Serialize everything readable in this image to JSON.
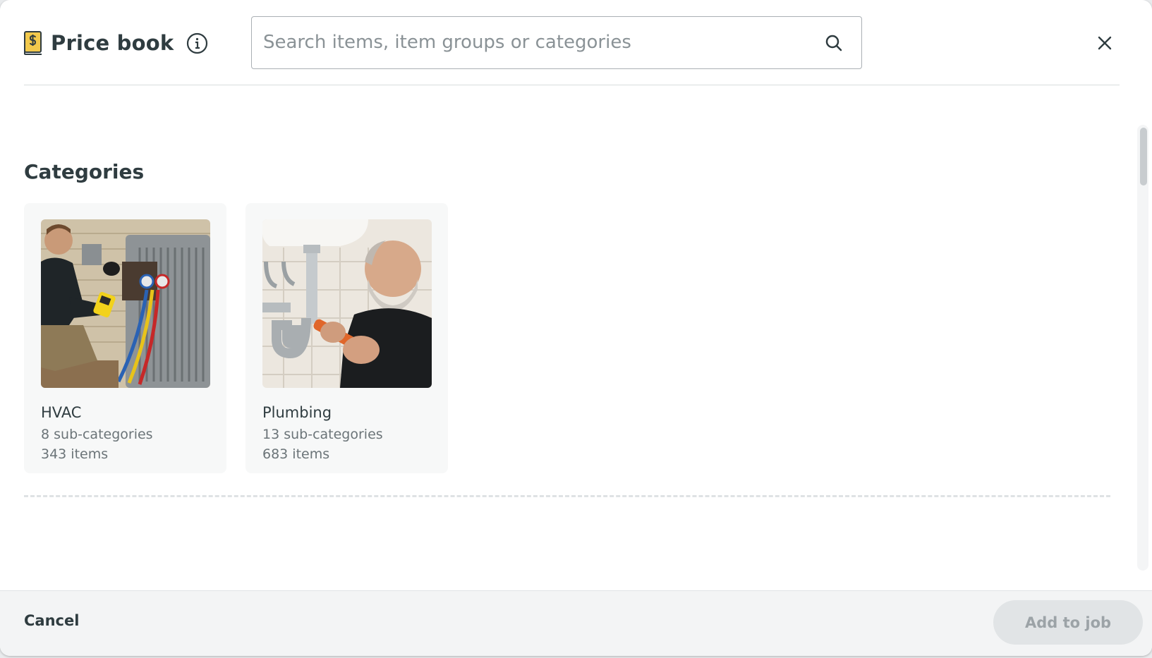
{
  "header": {
    "title": "Price book",
    "search": {
      "placeholder": "Search items, item groups or categories",
      "value": ""
    }
  },
  "icons": {
    "title_icon": "price-book-icon",
    "info": "info-icon",
    "search": "search-icon",
    "close": "close-icon"
  },
  "main": {
    "section_title": "Categories",
    "categories": [
      {
        "name": "HVAC",
        "subcategories": "8 sub-categories",
        "items": "343 items",
        "image": "hvac-technician-photo"
      },
      {
        "name": "Plumbing",
        "subcategories": "13 sub-categories",
        "items": "683 items",
        "image": "plumber-photo"
      }
    ]
  },
  "footer": {
    "cancel_label": "Cancel",
    "add_label": "Add to job",
    "add_enabled": false
  },
  "colors": {
    "text_primary": "#2f3c40",
    "text_secondary": "#6b7478",
    "book_icon": "#f2c94c",
    "card_background": "#f7f8f8",
    "footer_background": "#f3f4f5",
    "disabled_button": "#e1e4e6"
  }
}
